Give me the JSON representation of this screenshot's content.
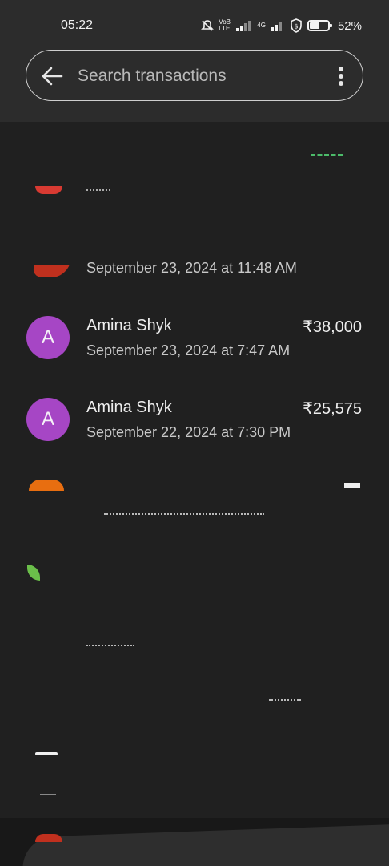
{
  "status_bar": {
    "time": "05:22",
    "volte_label": "VoB LTE",
    "network_label": "4G",
    "battery_percent": "52%",
    "battery_level": 0.52
  },
  "search": {
    "placeholder": "Search transactions"
  },
  "transactions": [
    {
      "name": "",
      "date": "September 23, 2024 at 11:48 AM",
      "amount": ""
    },
    {
      "avatar_letter": "A",
      "name": "Amina Shyk",
      "date": "September 23, 2024 at 7:47 AM",
      "amount": "₹38,000"
    },
    {
      "avatar_letter": "A",
      "name": "Amina Shyk",
      "date": "September 22, 2024 at 7:30 PM",
      "amount": "₹25,575"
    }
  ],
  "colors": {
    "avatar": "#a646c5",
    "background": "#202020",
    "header": "#2c2c2c"
  }
}
